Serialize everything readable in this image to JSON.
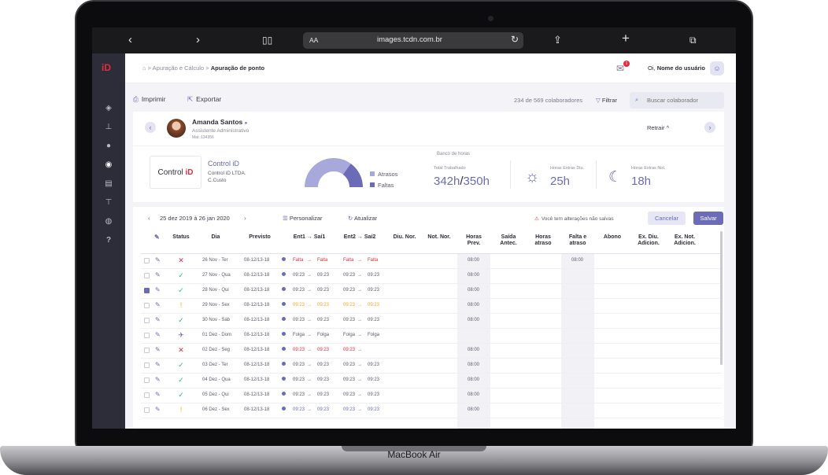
{
  "device": {
    "label": "MacBook Air"
  },
  "browser": {
    "aa": "AA",
    "url": "images.tcdn.com.br"
  },
  "app": {
    "logo": "iD"
  },
  "breadcrumb": {
    "parent": "Apuração e Cálculo",
    "current": "Apuração de ponto"
  },
  "header": {
    "notifications": "1",
    "greeting_prefix": "Oi,",
    "user": "Nome do usuário"
  },
  "toolbar": {
    "print": "Imprimir",
    "export": "Exportar",
    "count": "234 de 569 colaboradores",
    "filter": "Filtrar",
    "search_placeholder": "Buscar colaborador"
  },
  "employee": {
    "name": "Amanda Santos",
    "role": "Assistente Administrativo",
    "mat": "Mat.:134356",
    "collapse": "Retrair"
  },
  "company": {
    "logo_text": "Control",
    "logo_mark": "iD",
    "name": "Control iD",
    "legal": "Control iD LTDA.",
    "cost": "C.Custo"
  },
  "donut_chart": {
    "legend": [
      {
        "label": "Atrasos",
        "color": "#a8a8da",
        "value": 0.7
      },
      {
        "label": "Faltas",
        "color": "#6b6bb8",
        "value": 0.3
      }
    ]
  },
  "bank": {
    "title": "Banco de horas",
    "total_label": "Total Trabalhado",
    "total_done": "342h",
    "total_sep": "/",
    "total_goal": "350h",
    "extra_day_label": "Horas Extras Diu.",
    "extra_day": "25h",
    "extra_night_label": "Horas Extras Not.",
    "extra_night": "18h"
  },
  "period": {
    "range": "25 dez 2019 à 26 jan 2020",
    "customize": "Personalizar",
    "refresh": "Atualizar",
    "unsaved": "Você tem alterações não salvas",
    "cancel": "Cancelar",
    "save": "Salvar"
  },
  "columns": [
    {
      "label": "Status"
    },
    {
      "label": "Dia"
    },
    {
      "label": "Previsto"
    },
    {
      "label": "Ent1 → Saí1"
    },
    {
      "label": "Ent2 → Saí2"
    },
    {
      "label": "Diu. Nor."
    },
    {
      "label": "Not. Nor."
    },
    {
      "label": "Horas Prev."
    },
    {
      "label": "Saída Antec."
    },
    {
      "label": "Horas atraso"
    },
    {
      "label": "Falta e atraso"
    },
    {
      "label": "Abono"
    },
    {
      "label": "Ex. Diu. Adicion."
    },
    {
      "label": "Ex. Not. Adicion."
    }
  ],
  "rows": [
    {
      "checked": false,
      "status": "✕",
      "status_color": "#e5293f",
      "day": "26 Nov - Ter",
      "plan": "08-12/13-18",
      "e1": "Falta",
      "s1": "Falta",
      "e2": "Falta",
      "s2": "Falta",
      "color": "#e5293f",
      "prev": "08:00",
      "falta": "08:00"
    },
    {
      "checked": false,
      "status": "✓",
      "status_color": "#2eb872",
      "day": "27 Nov - Qua",
      "plan": "08-12/13-18",
      "e1": "09:23",
      "s1": "09:23",
      "e2": "09:23",
      "s2": "09:23",
      "color": "#5a5a6c",
      "prev": "08:00",
      "falta": ""
    },
    {
      "checked": true,
      "status": "✓",
      "status_color": "#2eb872",
      "day": "28 Nov - Qui",
      "plan": "08-12/13-18",
      "e1": "09:23",
      "s1": "09:23",
      "e2": "09:23",
      "s2": "09:23",
      "color": "#5a5a6c",
      "prev": "08:00",
      "falta": ""
    },
    {
      "checked": false,
      "status": "!",
      "status_color": "#f5a623",
      "day": "29 Nov - Sex",
      "plan": "08-12/13-18",
      "e1": "09:23",
      "s1": "09:23",
      "e2": "09:23",
      "s2": "09:23",
      "color": "#f5a623",
      "prev": "08:00",
      "falta": ""
    },
    {
      "checked": false,
      "status": "✓",
      "status_color": "#2eb872",
      "day": "30 Nov - Sáb",
      "plan": "08-12/13-18",
      "e1": "09:23",
      "s1": "09:23",
      "e2": "09:23",
      "s2": "09:23",
      "color": "#5a5a6c",
      "prev": "08:00",
      "falta": ""
    },
    {
      "checked": false,
      "status": "✈",
      "status_color": "#6b6bb8",
      "day": "01 Dez - Dom",
      "plan": "08-12/13-18",
      "e1": "Folga",
      "s1": "Folga",
      "e2": "Folga",
      "s2": "Folga",
      "color": "#5a5a6c",
      "prev": "",
      "falta": ""
    },
    {
      "checked": false,
      "status": "✕",
      "status_color": "#e5293f",
      "day": "02 Dez - Seg",
      "plan": "08-12/13-18",
      "e1": "09:23",
      "s1": "09:23",
      "e2": "09:23",
      "s2": "",
      "color": "#e5293f",
      "prev": "08:00",
      "falta": ""
    },
    {
      "checked": false,
      "status": "✓",
      "status_color": "#2eb872",
      "day": "03 Dez - Ter",
      "plan": "08-12/13-18",
      "e1": "09:23",
      "s1": "09:23",
      "e2": "09:23",
      "s2": "09:23",
      "color": "#5a5a6c",
      "prev": "08:00",
      "falta": ""
    },
    {
      "checked": false,
      "status": "✓",
      "status_color": "#2eb872",
      "day": "04 Dez - Qua",
      "plan": "08-12/13-18",
      "e1": "09:23",
      "s1": "09:23",
      "e2": "09:23",
      "s2": "09:23",
      "color": "#5a5a6c",
      "prev": "08:00",
      "falta": ""
    },
    {
      "checked": false,
      "status": "✓",
      "status_color": "#2eb872",
      "day": "05 Dez - Qui",
      "plan": "08-12/13-18",
      "e1": "09:23",
      "s1": "09:23",
      "e2": "09:23",
      "s2": "09:23",
      "color": "#5a5a6c",
      "prev": "08:00",
      "falta": ""
    },
    {
      "checked": false,
      "status": "!",
      "status_color": "#f5a623",
      "day": "06 Dez - Sex",
      "plan": "08-12/13-18",
      "e1": "09:23",
      "s1": "09:23",
      "e2": "09:23",
      "s2": "09:23",
      "color": "#6b6bb8",
      "prev": "08:00",
      "falta": ""
    }
  ]
}
